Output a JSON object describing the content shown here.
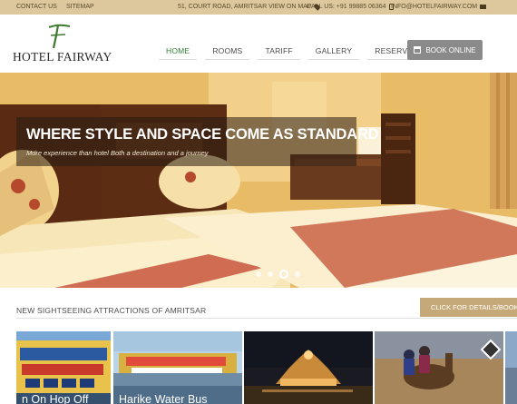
{
  "topbar": {
    "contact": "CONTACT US",
    "sitemap": "SITEMAP",
    "address": "51, COURT ROAD, AMRITSAR VIEW ON MAP",
    "call": "CALL US: +91 99885 06364",
    "email": "INFO@HOTELFAIRWAY.COM",
    "icons": [
      "map-pin-icon",
      "phone-icon",
      "mail-icon"
    ]
  },
  "header": {
    "logo_text": "HOTEL FAIRWAY",
    "nav": [
      "HOME",
      "ROOMS",
      "TARIFF",
      "GALLERY",
      "RESERVATION"
    ],
    "active_nav": "HOME",
    "book_label": "BOOK ONLINE",
    "accent": "#2e7d32"
  },
  "hero": {
    "title": "WHERE STYLE AND SPACE COME AS STANDARD",
    "subtitle": "More experience than hotel Both a destination and a journey",
    "slides": 4,
    "active_slide": 3
  },
  "attractions": {
    "heading": "NEW SIGHTSEEING ATTRACTIONS OF AMRITSAR",
    "details_button": "CLICK FOR DETAILS/BOOKI",
    "items": [
      {
        "label": "n On Hop Off"
      },
      {
        "label": "Harike Water Bus"
      },
      {
        "label": ""
      },
      {
        "label": ""
      },
      {
        "label": ""
      }
    ]
  },
  "colors": {
    "topbar": "#dcc89c",
    "button_gold": "#c6a978",
    "button_grey": "#8a8a8a"
  }
}
